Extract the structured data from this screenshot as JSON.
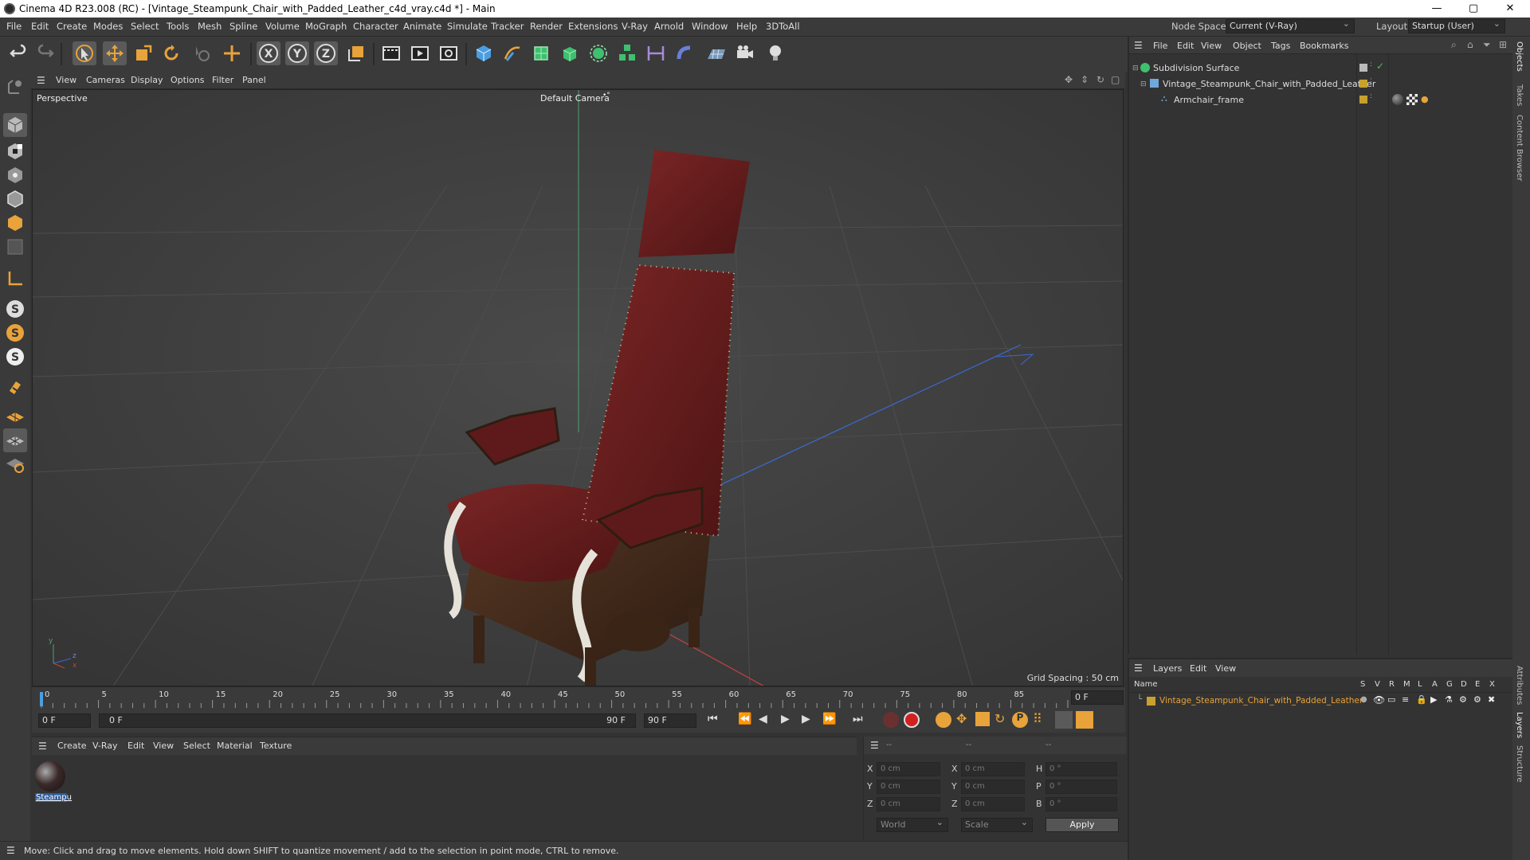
{
  "window": {
    "title": "Cinema 4D R23.008 (RC) - [Vintage_Steampunk_Chair_with_Padded_Leather_c4d_vray.c4d *] - Main",
    "controls": [
      "—",
      "▢",
      "✕"
    ]
  },
  "menubar": {
    "items": [
      "File",
      "Edit",
      "Create",
      "Modes",
      "Select",
      "Tools",
      "Mesh",
      "Spline",
      "Volume",
      "MoGraph",
      "Character",
      "Animate",
      "Simulate",
      "Tracker",
      "Render",
      "Extensions",
      "V-Ray",
      "Arnold",
      "Window",
      "Help",
      "3DToAll"
    ],
    "node_space_label": "Node Space:",
    "node_space_value": "Current (V-Ray)",
    "layout_label": "Layout:",
    "layout_value": "Startup (User)"
  },
  "toolbar": {
    "icons": [
      "undo-icon",
      "redo-icon",
      "select-icon",
      "move-icon",
      "scale-icon",
      "rotate-icon",
      "live-select-icon",
      "add-icon",
      "x-axis-icon",
      "y-axis-icon",
      "z-axis-icon",
      "coordinate-system-icon",
      "render-region-icon",
      "render-view-icon",
      "render-settings-icon",
      "cube-icon",
      "pen-icon",
      "subdivision-icon",
      "extrude-icon",
      "cloner-icon",
      "array-icon",
      "symmetry-icon",
      "deformer-icon",
      "floor-icon",
      "camera-icon",
      "light-icon"
    ],
    "axis_labels": [
      "X",
      "Y",
      "Z"
    ]
  },
  "left_toolbar": {
    "icons": [
      "model-mode-icon",
      "texture-mode-icon",
      "points-mode-icon",
      "edges-mode-icon",
      "polygons-mode-icon",
      "object-mode-icon",
      "axis-icon",
      "snap-s-icon",
      "snap-s-orange-icon",
      "snap-s-white-icon",
      "magnet-icon",
      "workplane-icon",
      "grid-icon",
      "solo-icon"
    ]
  },
  "viewport": {
    "menu": [
      "View",
      "Cameras",
      "Display",
      "Options",
      "Filter",
      "Panel"
    ],
    "label": "Perspective",
    "camera": "Default Camera",
    "grid_spacing": "Grid Spacing : 50 cm",
    "axis_y": "y",
    "axis_z": "z",
    "axis_x": "x"
  },
  "timeline": {
    "ticks": [
      "0",
      "5",
      "10",
      "15",
      "20",
      "25",
      "30",
      "35",
      "40",
      "45",
      "50",
      "55",
      "60",
      "65",
      "70",
      "75",
      "80",
      "85",
      "90"
    ],
    "current_frame": "0 F"
  },
  "transport": {
    "start_field": "0 F",
    "range_start": "0 F",
    "range_end": "90 F",
    "end_field": "90 F"
  },
  "material_panel": {
    "menu": [
      "Create",
      "V-Ray",
      "Edit",
      "View",
      "Select",
      "Material",
      "Texture"
    ],
    "materials": [
      {
        "name": "Steampu"
      }
    ]
  },
  "coord_panel": {
    "headers": [
      "--",
      "--",
      "--"
    ],
    "rows": [
      {
        "a": "X",
        "av": "0 cm",
        "b": "X",
        "bv": "0 cm",
        "c": "H",
        "cv": "0 °"
      },
      {
        "a": "Y",
        "av": "0 cm",
        "b": "Y",
        "bv": "0 cm",
        "c": "P",
        "cv": "0 °"
      },
      {
        "a": "Z",
        "av": "0 cm",
        "b": "Z",
        "bv": "0 cm",
        "c": "B",
        "cv": "0 °"
      }
    ],
    "world": "World",
    "scale": "Scale",
    "apply": "Apply"
  },
  "object_panel": {
    "menu": [
      "File",
      "Edit",
      "View",
      "Object",
      "Tags",
      "Bookmarks"
    ],
    "objects": [
      {
        "name": "Subdivision Surface",
        "color": "#9ec24a"
      },
      {
        "name": "Vintage_Steampunk_Chair_with_Padded_Leather",
        "color": "#6fa8dc"
      },
      {
        "name": "Armchair_frame",
        "color": "#6fa8dc"
      }
    ]
  },
  "layer_panel": {
    "menu": [
      "Layers",
      "Edit",
      "View"
    ],
    "col_name": "Name",
    "cols": [
      "S",
      "V",
      "R",
      "M",
      "L",
      "A",
      "G",
      "D",
      "E",
      "X"
    ],
    "layers": [
      {
        "name": "Vintage_Steampunk_Chair_with_Padded_Leather",
        "color": "#c8a030"
      }
    ]
  },
  "right_tabs": [
    "Objects",
    "Takes",
    "Content Browser",
    "Attributes",
    "Layers",
    "Structure"
  ],
  "status": {
    "text": "Move: Click and drag to move elements. Hold down SHIFT to quantize movement / add to the selection in point mode, CTRL to remove."
  },
  "colors": {
    "accent_orange": "#e8a33a",
    "axis_x": "#c84040",
    "axis_y": "#40a060",
    "axis_z": "#3a6ad0",
    "leather": "#6a1f1f",
    "wood": "#4a3020"
  }
}
